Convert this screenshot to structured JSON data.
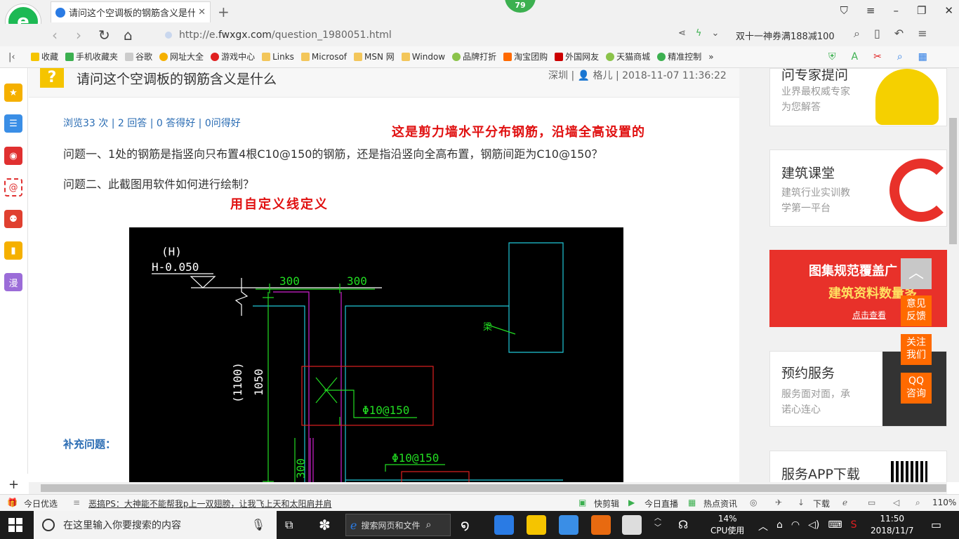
{
  "browser": {
    "tab_title": "请问这个空调板的钢筋含义是什么",
    "badge": "79",
    "url_prefix": "http://e.",
    "url_domain": "fwxgx.com",
    "url_path": "/question_1980051.html",
    "promo": "双十一神券满188减100"
  },
  "bookmarks": [
    "收藏",
    "手机收藏夹",
    "谷歌",
    "网址大全",
    "游戏中心",
    "Links",
    "Microsof",
    "MSN 网",
    "Window",
    "品牌打折",
    "淘宝团购",
    "外国网友",
    "天猫商城",
    "精准控制"
  ],
  "question": {
    "mark": "?",
    "title": "请问这个空调板的钢筋含义是什么",
    "meta": "深圳 | 👤 格儿 | 2018-11-07 11:36:22",
    "stats": "浏览33 次 | 2 回答 | 0 答得好 | 0问得好",
    "annotation1": "这是剪力墙水平分布钢筋，沿墙全高设置的",
    "q1": "问题一、1处的钢筋是指竖向只布置4根C10@150的钢筋，还是指沿竖向全高布置，钢筋间距为C10@150？",
    "q2": "问题二、此截图用软件如何进行绘制？",
    "annotation2": "用自定义线定义",
    "supplement": "补充问题："
  },
  "cad": {
    "h_label": "(H)",
    "elev_label": "H-0.050",
    "dim1": "300",
    "dim2": "300",
    "dim_v1": "(1100)",
    "dim_v2": "1050",
    "rebar1": "Φ10@150",
    "rebar2": "Φ10@150",
    "beam_label": "梁",
    "dim3": "300"
  },
  "rail": {
    "card0_title": "问专家提问",
    "card0_sub1": "业界最权威专家",
    "card0_sub2": "为您解答",
    "card1_title": "建筑课堂",
    "card1_sub1": "建筑行业实训教",
    "card1_sub2": "学第一平台",
    "banner_line1": "图集规范覆盖广",
    "banner_line2": "建筑资料数量多",
    "banner_link": "点击查看",
    "card2_title": "预约服务",
    "card2_sub1": "服务面对面，承",
    "card2_sub2": "诺心连心",
    "card3_title": "服务APP下载"
  },
  "sidebtns": {
    "feedback": "意见反馈",
    "follow": "关注我们",
    "qq": "QQ咨询"
  },
  "statusbar": {
    "today": "今日优选",
    "news": "恶搞PS：大神能不能帮我p上一双翅膀，让我飞上天和太阳肩并肩",
    "kuaijian": "快剪辑",
    "live": "今日直播",
    "hot": "热点资讯",
    "download": "下载",
    "zoom": "110%"
  },
  "taskbar": {
    "search_placeholder": "在这里输入你要搜索的内容",
    "browser_search": "搜索网页和文件",
    "cpu_pct": "14%",
    "cpu_label": "CPU使用",
    "time": "11:50",
    "date": "2018/11/7"
  }
}
